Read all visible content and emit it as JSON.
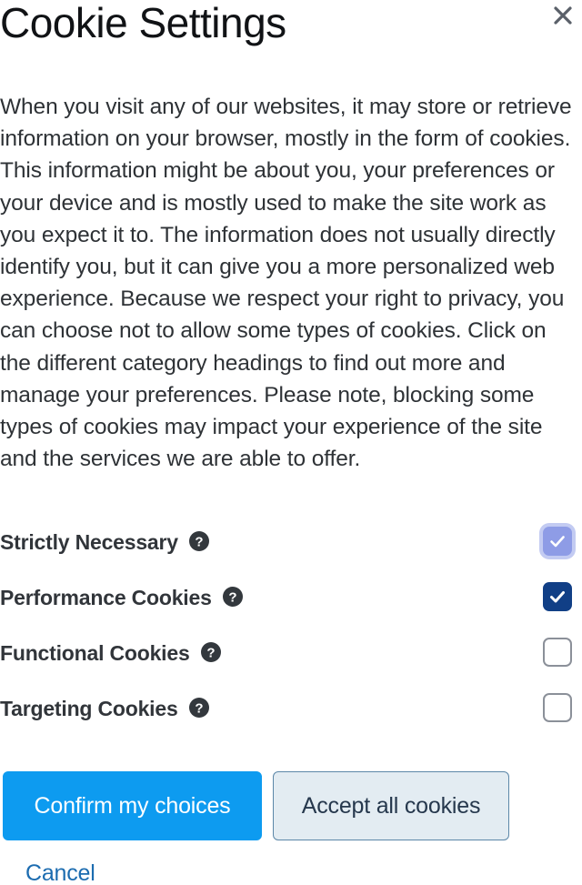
{
  "dialog": {
    "title": "Cookie Settings",
    "close_icon": "close-icon",
    "intro": "When you visit any of our websites, it may store or retrieve information on your browser, mostly in the form of cookies. This information might be about you, your preferences or your device and is mostly used to make the site work as you expect it to. The information does not usually directly identify you, but it can give you a more personalized web experience. Because we respect your right to privacy, you can choose not to allow some types of cookies. Click on the different category headings to find out more and manage your preferences. Please note, blocking some types of cookies may impact your experience of the site and the services we are able to offer."
  },
  "categories": [
    {
      "label": "Strictly Necessary",
      "help_icon": "help-circle-icon",
      "state": "locked",
      "checked": true
    },
    {
      "label": "Performance Cookies",
      "help_icon": "help-circle-icon",
      "state": "checked",
      "checked": true
    },
    {
      "label": "Functional Cookies",
      "help_icon": "help-circle-icon",
      "state": "unchecked",
      "checked": false
    },
    {
      "label": "Targeting Cookies",
      "help_icon": "help-circle-icon",
      "state": "unchecked",
      "checked": false
    }
  ],
  "actions": {
    "confirm_label": "Confirm my choices",
    "accept_all_label": "Accept all cookies",
    "cancel_label": "Cancel"
  },
  "colors": {
    "primary_button": "#0d9bf0",
    "secondary_button_bg": "#e3ecf2",
    "secondary_button_border": "#5c87a8",
    "checked_box": "#113f86",
    "locked_box": "#8e9ce6",
    "locked_box_halo": "#c3cbf2",
    "unchecked_border": "#8b9099",
    "link": "#1c6cb0",
    "help_icon": "#33383d",
    "close_icon": "#5a6069"
  }
}
